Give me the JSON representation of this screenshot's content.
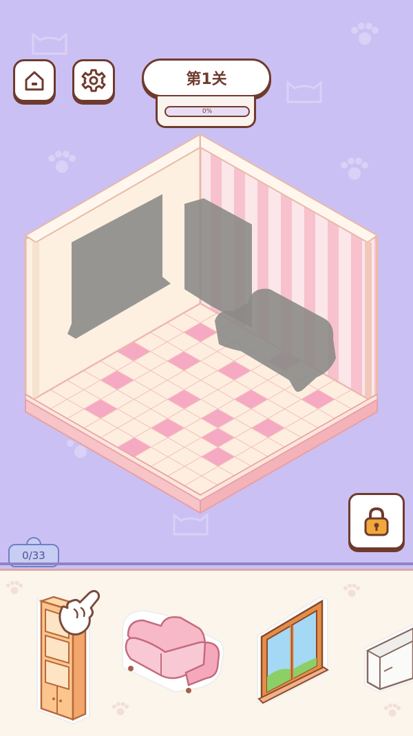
{
  "header": {
    "level_label": "第1关",
    "progress_percent": 0,
    "progress_text": "0%"
  },
  "icons": {
    "home": "home-icon",
    "settings": "gear-icon",
    "lock": "lock-icon"
  },
  "counter": {
    "text": "0/33",
    "collected": 0,
    "total": 33
  },
  "tray": {
    "items": [
      "bookshelf",
      "sofa",
      "window",
      "cabinet"
    ]
  },
  "colors": {
    "background": "#cbc0f3",
    "outline": "#6f3a2e",
    "floor_pink": "#f6a9c2",
    "floor_cream": "#fdeee0",
    "stripe_pink": "#f7c2cd",
    "lock_gold": "#f0a83a"
  }
}
